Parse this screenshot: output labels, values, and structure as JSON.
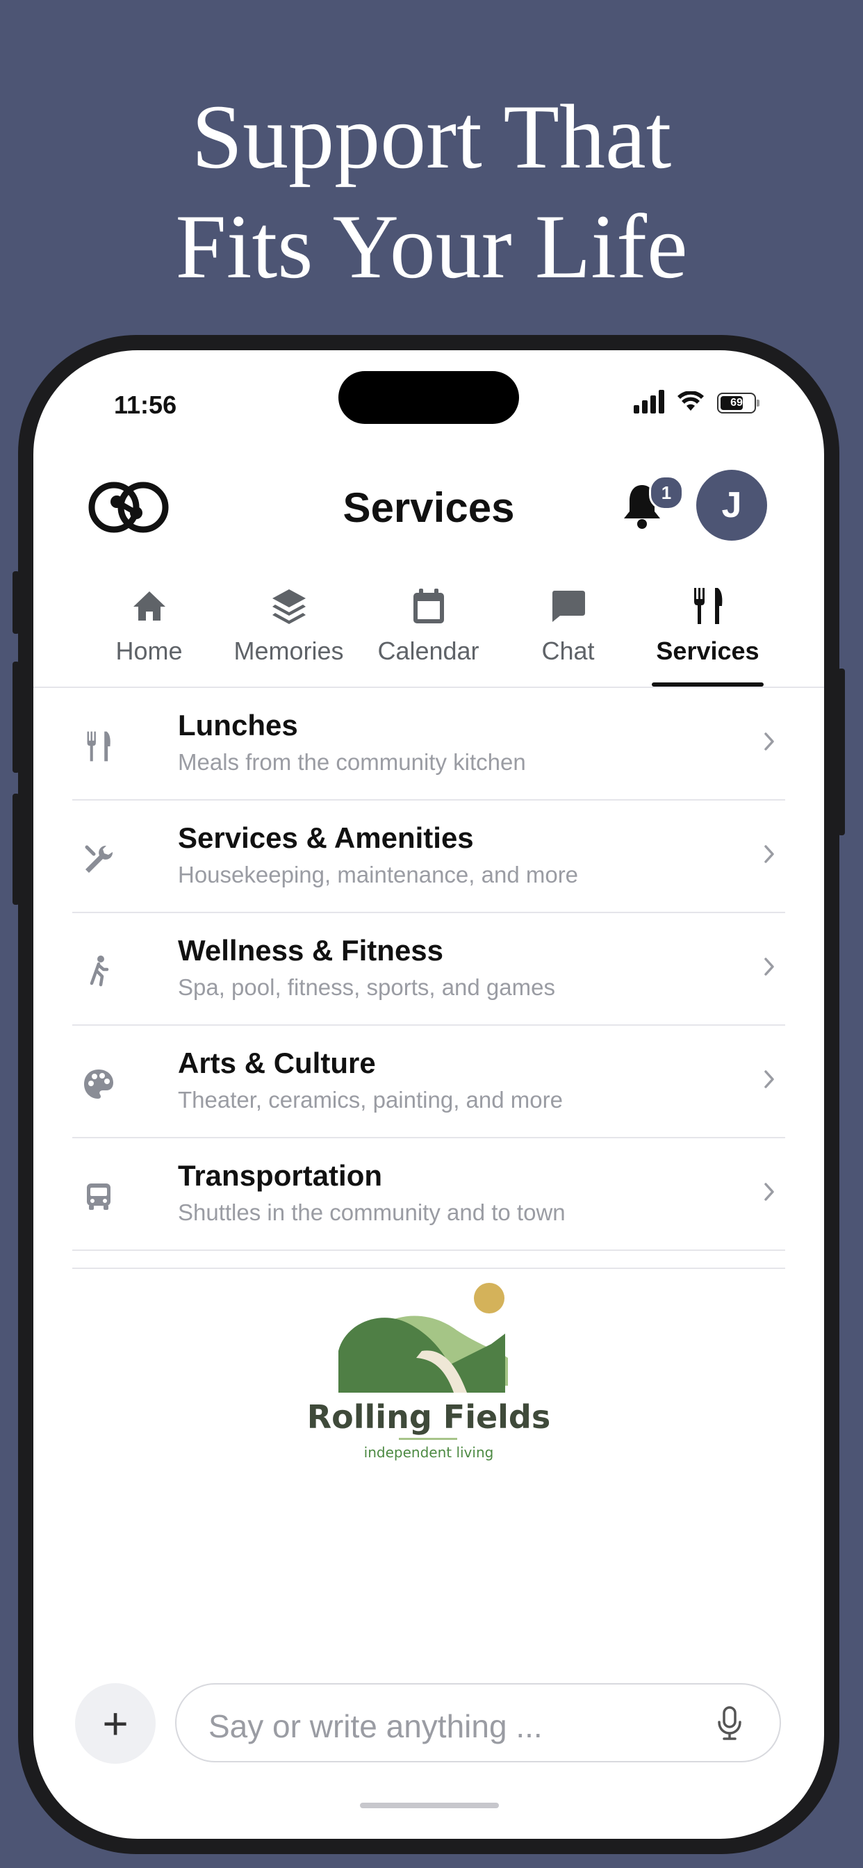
{
  "hero": {
    "line1": "Support That",
    "line2": "Fits Your Life"
  },
  "status_bar": {
    "time": "11:56",
    "battery": "69"
  },
  "header": {
    "title": "Services",
    "notification_count": "1",
    "avatar_initial": "J"
  },
  "tabs": [
    {
      "label": "Home",
      "icon": "home-icon"
    },
    {
      "label": "Memories",
      "icon": "layers-icon"
    },
    {
      "label": "Calendar",
      "icon": "calendar-icon"
    },
    {
      "label": "Chat",
      "icon": "chat-icon"
    },
    {
      "label": "Services",
      "icon": "fork-knife-icon",
      "active": true
    }
  ],
  "services": [
    {
      "title": "Lunches",
      "subtitle": "Meals from the community kitchen",
      "icon": "fork-knife-icon"
    },
    {
      "title": "Services & Amenities",
      "subtitle": "Housekeeping, maintenance, and more",
      "icon": "wrench-icon"
    },
    {
      "title": "Wellness & Fitness",
      "subtitle": "Spa, pool, fitness, sports, and games",
      "icon": "walking-icon"
    },
    {
      "title": "Arts & Culture",
      "subtitle": "Theater, ceramics, painting, and more",
      "icon": "palette-icon"
    },
    {
      "title": "Transportation",
      "subtitle": "Shuttles in the community and to town",
      "icon": "bus-icon"
    }
  ],
  "brand": {
    "name": "Rolling Fields",
    "tagline": "independent living"
  },
  "composer": {
    "placeholder": "Say or write anything ...",
    "plus_label": "+"
  },
  "colors": {
    "accent": "#4d5574",
    "background": "#4d5574",
    "icon_gray": "#8a8d96"
  }
}
